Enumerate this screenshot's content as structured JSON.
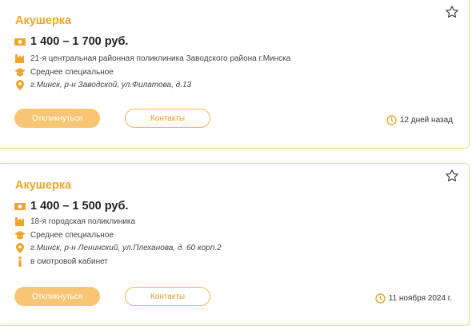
{
  "vacancies": [
    {
      "title": "Акушерка",
      "salary": "1 400 – 1 700 руб.",
      "employer": "21-я центральная районная поликлиника Заводского района г.Минска",
      "education": "Среднее специальное",
      "address": "г.Минск, р-н Заводской, ул.Филатова, д.13",
      "respond_label": "Откликнуться",
      "contacts_label": "Контакты",
      "posted": "12 дней назад"
    },
    {
      "title": "Акушерка",
      "salary": "1 400 – 1 500 руб.",
      "employer": "18-я городская поликлиника",
      "education": "Среднее специальное",
      "address": "г.Минск, р-н Ленинский, ул.Плеханова, д. 60 корп.2",
      "note": "в смотровой кабинет",
      "respond_label": "Откликнуться",
      "contacts_label": "Контакты",
      "posted": "11 ноября 2024 г."
    }
  ],
  "colors": {
    "accent": "#f0a52a",
    "button_fill": "#f7c574",
    "border": "#f3d38c"
  },
  "icons": [
    "star-icon",
    "money-icon",
    "building-icon",
    "graduation-cap-icon",
    "location-pin-icon",
    "info-icon",
    "clock-icon"
  ]
}
